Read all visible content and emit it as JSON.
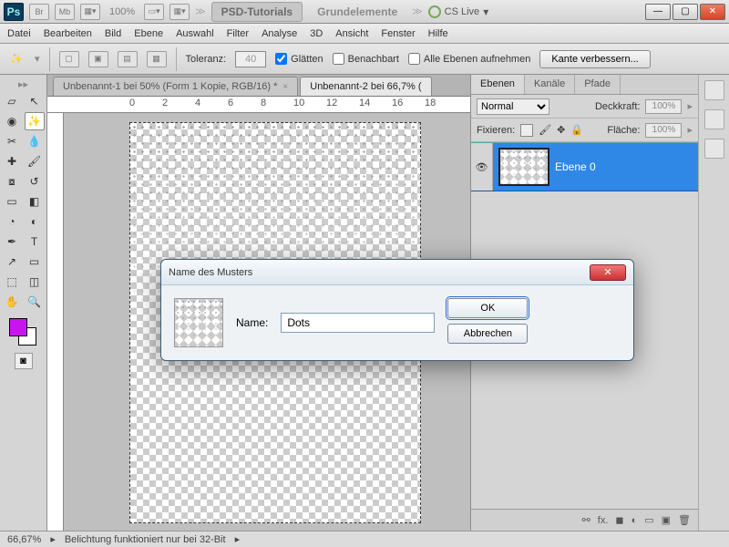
{
  "app": {
    "logo": "Ps",
    "zoom_top": "100%",
    "cslive": "CS Live"
  },
  "top_tabs": {
    "a": "PSD-Tutorials",
    "b": "Grundelemente"
  },
  "top_small": {
    "br": "Br",
    "mb": "Mb"
  },
  "menu": {
    "datei": "Datei",
    "bearbeiten": "Bearbeiten",
    "bild": "Bild",
    "ebene": "Ebene",
    "auswahl": "Auswahl",
    "filter": "Filter",
    "analyse": "Analyse",
    "drei_d": "3D",
    "ansicht": "Ansicht",
    "fenster": "Fenster",
    "hilfe": "Hilfe"
  },
  "options": {
    "toleranz_label": "Toleranz:",
    "toleranz_value": "40",
    "glaetten": "Glätten",
    "benachbart": "Benachbart",
    "alle_ebenen": "Alle Ebenen aufnehmen",
    "kante": "Kante verbessern..."
  },
  "doc_tabs": {
    "t1": "Unbenannt-1 bei 50% (Form 1 Kopie, RGB/16) *",
    "t2": "Unbenannt-2 bei 66,7% ("
  },
  "ruler": {
    "m0": "0",
    "m2": "2",
    "m4": "4",
    "m6": "6",
    "m8": "8",
    "m10": "10",
    "m12": "12",
    "m14": "14",
    "m16": "16",
    "m18": "18"
  },
  "panels": {
    "tab_ebenen": "Ebenen",
    "tab_kanaele": "Kanäle",
    "tab_pfade": "Pfade",
    "blend": "Normal",
    "deckkraft_label": "Deckkraft:",
    "deckkraft_val": "100%",
    "fixieren": "Fixieren:",
    "flaeche_label": "Fläche:",
    "flaeche_val": "100%",
    "layer0": "Ebene 0",
    "foot_fx": "fx."
  },
  "status": {
    "zoom": "66,67%",
    "msg": "Belichtung funktioniert nur bei 32-Bit"
  },
  "dialog": {
    "title": "Name des Musters",
    "name_label": "Name:",
    "name_value": "Dots",
    "ok": "OK",
    "cancel": "Abbrechen"
  }
}
